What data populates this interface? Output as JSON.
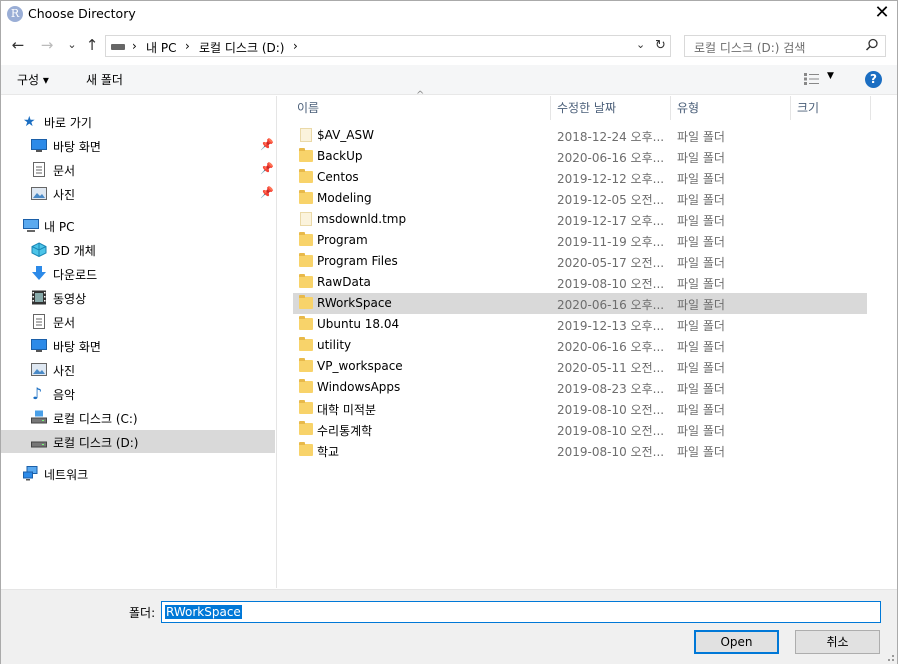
{
  "window": {
    "title": "Choose Directory",
    "app_icon": "R"
  },
  "nav": {
    "back": "←",
    "forward": "→",
    "recent": "⌄",
    "up": "↑"
  },
  "breadcrumb": [
    "내 PC",
    "로컬 디스크 (D:)"
  ],
  "search": {
    "placeholder": "로컬 디스크 (D:) 검색"
  },
  "toolbar": {
    "organize": "구성",
    "new_folder": "새 폴더",
    "help": "?"
  },
  "sidebar": {
    "quick_access": "바로 가기",
    "quick_items": [
      {
        "label": "바탕 화면",
        "icon": "desktop-icon"
      },
      {
        "label": "문서",
        "icon": "documents-icon"
      },
      {
        "label": "사진",
        "icon": "pictures-icon"
      }
    ],
    "this_pc": "내 PC",
    "pc_items": [
      {
        "label": "3D 개체",
        "icon": "3d-objects-icon"
      },
      {
        "label": "다운로드",
        "icon": "downloads-icon"
      },
      {
        "label": "동영상",
        "icon": "videos-icon"
      },
      {
        "label": "문서",
        "icon": "documents-icon"
      },
      {
        "label": "바탕 화면",
        "icon": "desktop-icon"
      },
      {
        "label": "사진",
        "icon": "pictures-icon"
      },
      {
        "label": "음악",
        "icon": "music-icon"
      },
      {
        "label": "로컬 디스크 (C:)",
        "icon": "drive-icon"
      },
      {
        "label": "로컬 디스크 (D:)",
        "icon": "drive-icon"
      }
    ],
    "network": "네트워크"
  },
  "columns": [
    "이름",
    "수정한 날짜",
    "유형",
    "크기"
  ],
  "files": [
    {
      "name": "$AV_ASW",
      "date": "2018-12-24 오후...",
      "type": "파일 폴더",
      "kind": "faded"
    },
    {
      "name": "BackUp",
      "date": "2020-06-16 오후...",
      "type": "파일 폴더",
      "kind": "folder"
    },
    {
      "name": "Centos",
      "date": "2019-12-12 오후...",
      "type": "파일 폴더",
      "kind": "folder"
    },
    {
      "name": "Modeling",
      "date": "2019-12-05 오전...",
      "type": "파일 폴더",
      "kind": "folder"
    },
    {
      "name": "msdownld.tmp",
      "date": "2019-12-17 오후...",
      "type": "파일 폴더",
      "kind": "faded"
    },
    {
      "name": "Program",
      "date": "2019-11-19 오후...",
      "type": "파일 폴더",
      "kind": "folder"
    },
    {
      "name": "Program Files",
      "date": "2020-05-17 오전...",
      "type": "파일 폴더",
      "kind": "folder"
    },
    {
      "name": "RawData",
      "date": "2019-08-10 오전...",
      "type": "파일 폴더",
      "kind": "folder"
    },
    {
      "name": "RWorkSpace",
      "date": "2020-06-16 오후...",
      "type": "파일 폴더",
      "kind": "folder",
      "selected": true
    },
    {
      "name": "Ubuntu 18.04",
      "date": "2019-12-13 오후...",
      "type": "파일 폴더",
      "kind": "folder"
    },
    {
      "name": "utility",
      "date": "2020-06-16 오후...",
      "type": "파일 폴더",
      "kind": "folder"
    },
    {
      "name": "VP_workspace",
      "date": "2020-05-11 오전...",
      "type": "파일 폴더",
      "kind": "folder"
    },
    {
      "name": "WindowsApps",
      "date": "2019-08-23 오후...",
      "type": "파일 폴더",
      "kind": "folder"
    },
    {
      "name": "대학 미적분",
      "date": "2019-08-10 오전...",
      "type": "파일 폴더",
      "kind": "folder"
    },
    {
      "name": "수리통계학",
      "date": "2019-08-10 오전...",
      "type": "파일 폴더",
      "kind": "folder"
    },
    {
      "name": "학교",
      "date": "2019-08-10 오전...",
      "type": "파일 폴더",
      "kind": "folder"
    }
  ],
  "footer": {
    "folder_label": "폴더:",
    "folder_value": "RWorkSpace",
    "open": "Open",
    "cancel": "취소"
  },
  "colors": {
    "accent": "#0078d7",
    "selection": "#d9d9d9",
    "folder": "#f8d36a"
  }
}
